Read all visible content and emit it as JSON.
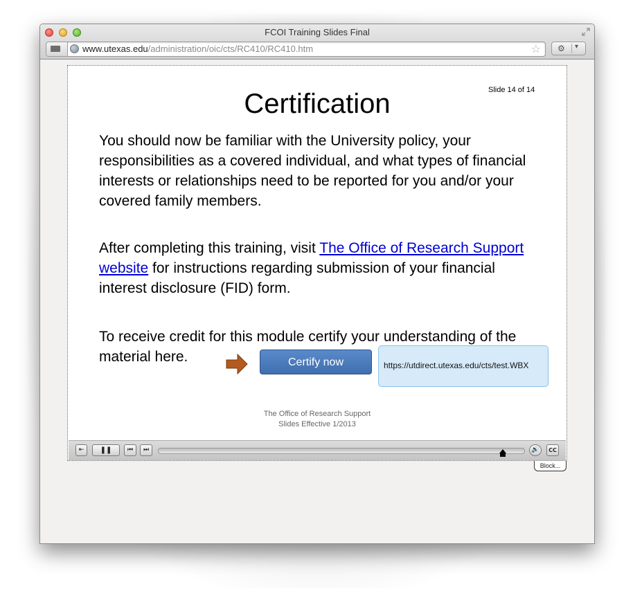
{
  "window": {
    "title": "FCOI Training Slides Final",
    "url_host": "www.utexas.edu",
    "url_path": "/administration/oic/cts/RC410/RC410.htm"
  },
  "icons": [
    "bookmarks-icon",
    "globe-icon",
    "star-icon",
    "extension-icon",
    "chevron-down-icon",
    "fullscreen-icon",
    "arrow-right-icon",
    "exit-icon",
    "pause-icon",
    "prev-icon",
    "next-icon",
    "volume-icon",
    "cc-icon"
  ],
  "slide": {
    "counter": "Slide 14 of 14",
    "title": "Certification",
    "para1": "You should now be familiar with the University policy, your responsibilities as a covered individual, and what types of financial interests or relationships need to be reported for you and/or your covered family members.",
    "para2_pre": "After completing this training, visit ",
    "para2_link": "The Office of Research Support website",
    "para2_post": " for instructions regarding submission of your financial interest disclosure (FID) form.",
    "para3": "To receive credit for this module certify your understanding of the material here.",
    "certify_label": "Certify now",
    "tooltip_url": "https://utdirect.utexas.edu/cts/test.WBX",
    "footer_line1": "The Office of Research Support",
    "footer_line2": "Slides Effective 1/2013"
  },
  "controls": {
    "playback_progress": 0.94,
    "block_label": "Block..."
  },
  "colors": {
    "link": "#0000d4",
    "button": "#4a7bbd",
    "arrow": "#b35a1f",
    "tooltip_bg": "#d6eaf9"
  }
}
